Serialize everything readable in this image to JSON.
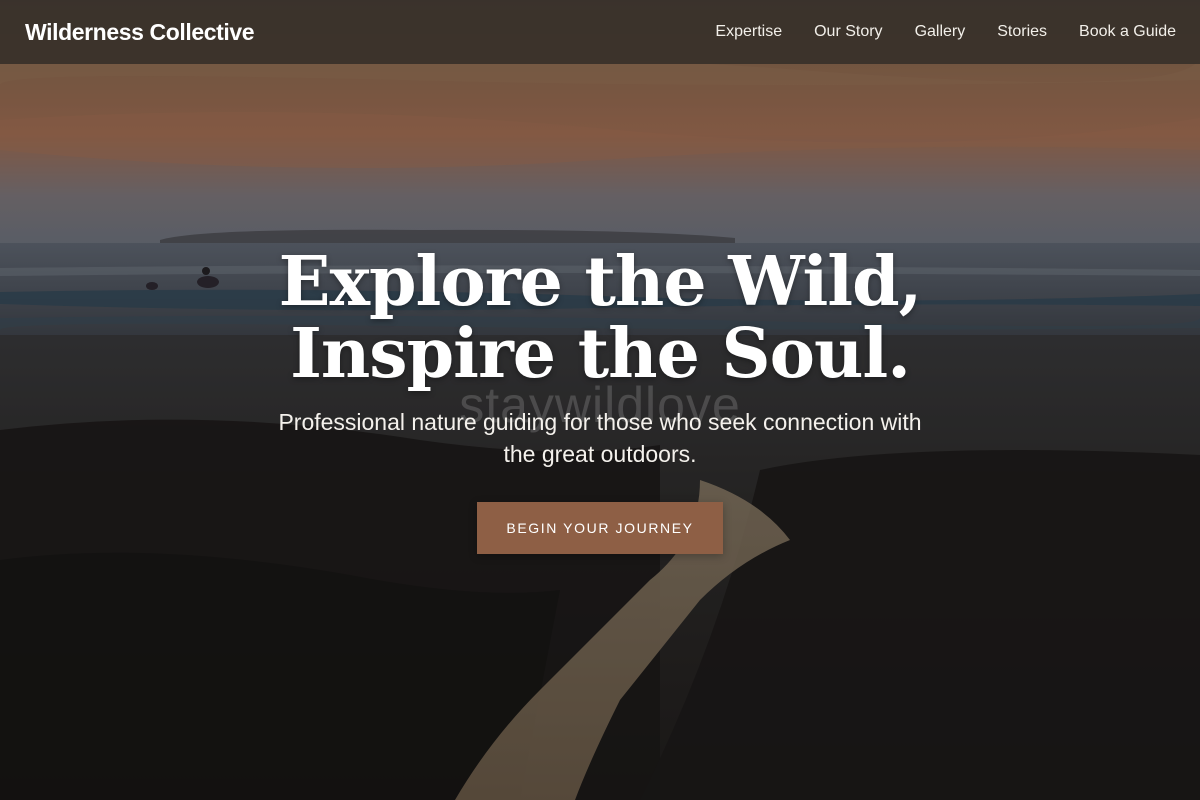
{
  "header": {
    "brand": "Wilderness Collective",
    "nav_items": [
      {
        "label": "Expertise"
      },
      {
        "label": "Our Story"
      },
      {
        "label": "Gallery"
      },
      {
        "label": "Stories"
      },
      {
        "label": "Book a Guide"
      }
    ]
  },
  "hero": {
    "title_line1": "Explore the Wild,",
    "title_line2": "Inspire the Soul.",
    "subtitle": "Professional nature guiding for those who seek connection with the great outdoors.",
    "watermark": "staywildlove",
    "cta_label": "BEGIN YOUR JOURNEY"
  },
  "colors": {
    "nav_background": "#3a322b",
    "cta_background": "#8e5f45",
    "text": "#ffffff"
  }
}
